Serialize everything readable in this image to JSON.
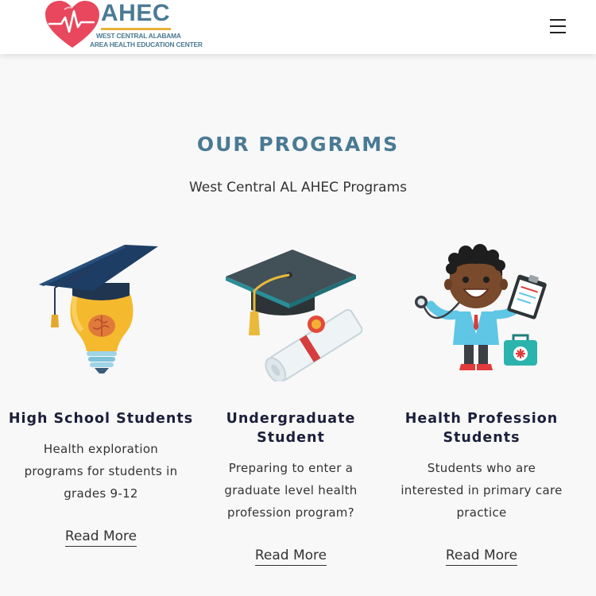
{
  "header": {
    "logo_title": "AHEC",
    "logo_line1": "WEST CENTRAL ALABAMA",
    "logo_line2": "AREA HEALTH EDUCATION CENTER"
  },
  "section": {
    "title": "OUR PROGRAMS",
    "subtitle": "West Central AL AHEC Programs"
  },
  "programs": [
    {
      "title": "High School Students",
      "description": "Health exploration programs for students in grades 9-12",
      "link": "Read More",
      "icon": "lightbulb-graduation-cap-icon"
    },
    {
      "title": "Undergraduate Student",
      "description": "Preparing to enter a graduate level health profession program?",
      "link": "Read More",
      "icon": "graduation-cap-diploma-icon"
    },
    {
      "title": "Health Profession Students",
      "description": "Students who are interested in primary care practice",
      "link": "Read More",
      "icon": "doctor-stethoscope-icon"
    }
  ],
  "colors": {
    "accent": "#4a7a94",
    "heading": "#1b1f3a",
    "logo_heart": "#e8475d",
    "logo_bar": "#e8b33a",
    "background": "#f8f8f8"
  }
}
